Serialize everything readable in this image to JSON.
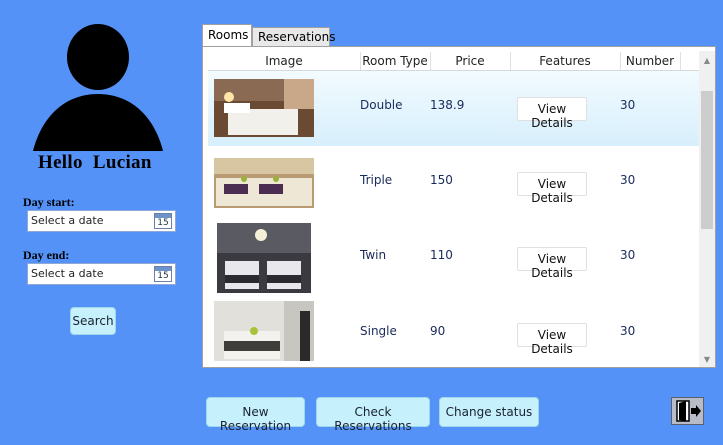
{
  "user": {
    "greeting_hello": "Hello",
    "name": "Lucian"
  },
  "filters": {
    "day_start_label": "Day start:",
    "day_end_label": "Day end:",
    "date_placeholder": "Select a date",
    "calendar_day": "15",
    "search_label": "Search"
  },
  "tabs": [
    "Rooms",
    "Reservations"
  ],
  "table": {
    "columns": [
      "Image",
      "Room Type",
      "Price",
      "Features",
      "Number"
    ],
    "rows": [
      {
        "room_type": "Double",
        "price": "138.9",
        "features": "View Details",
        "number": "30"
      },
      {
        "room_type": "Triple",
        "price": "150",
        "features": "View Details",
        "number": "30"
      },
      {
        "room_type": "Twin",
        "price": "110",
        "features": "View Details",
        "number": "30"
      },
      {
        "room_type": "Single",
        "price": "90",
        "features": "View Details",
        "number": "30"
      }
    ]
  },
  "actions": {
    "new_reservation": "New Reservation",
    "check_reservations": "Check Reservations",
    "change_status": "Change status"
  },
  "icons": {
    "exit": "exit-door-icon",
    "calendar": "calendar-icon",
    "avatar": "user-silhouette-icon"
  },
  "colors": {
    "background": "#5492f7",
    "button": "#c6f0fc",
    "selected_row": "#d7effc"
  }
}
